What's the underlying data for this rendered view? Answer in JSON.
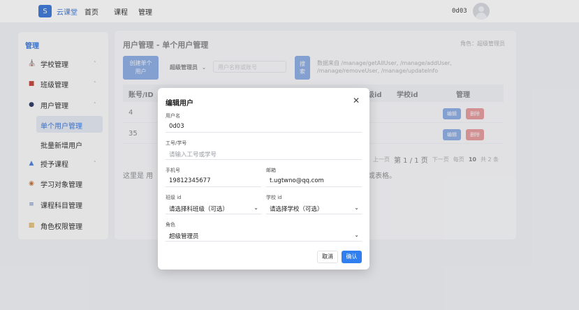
{
  "topnav": {
    "logo_letter": "S",
    "brand": "云课堂",
    "links": [
      "首页",
      "课程",
      "管理"
    ],
    "username": "0d03"
  },
  "sidebar": {
    "title": "管理",
    "items": [
      {
        "label": "学校管理",
        "icon": "school-icon"
      },
      {
        "label": "班级管理",
        "icon": "class-icon"
      },
      {
        "label": "用户管理",
        "icon": "user-icon"
      },
      {
        "label": "单个用户管理",
        "sub": true,
        "active": true
      },
      {
        "label": "批量新增用户",
        "sub": true
      },
      {
        "label": "授予课程",
        "icon": "grant-icon"
      },
      {
        "label": "学习对象管理",
        "icon": "target-icon"
      },
      {
        "label": "课程科目管理",
        "icon": "list-icon"
      },
      {
        "label": "角色权限管理",
        "icon": "lock-icon"
      }
    ]
  },
  "main": {
    "title": "用户管理 - 单个用户管理",
    "role": "角色：超级管理员",
    "create_button": "创建单个\n用户",
    "role_filter": "超级管理员",
    "search_placeholder": "用户名称或账号",
    "search_button": "搜\n索",
    "data_source": "数据来自 /manage/getAllUser, /manage/addUser, /manage/removeUser, /manage/updateInfo",
    "columns": [
      "账号/ID",
      "级id",
      "学校id",
      "管理"
    ],
    "rows": [
      {
        "id": "4",
        "edit": "编辑",
        "delete": "删除"
      },
      {
        "id": "35",
        "edit": "编辑",
        "delete": "删除"
      }
    ],
    "pager": {
      "prev": "上一页",
      "current": "第 1 / 1 页",
      "next": "下一页",
      "per_page_label": "每页",
      "per_page": "10",
      "total": "共 2 条"
    },
    "note_head": "这里是 用",
    "note_tail": "件或表格。"
  },
  "modal": {
    "title": "编辑用户",
    "username_label": "用户名",
    "username_value": "0d03",
    "workno_label": "工号/学号",
    "workno_placeholder": "请输入工号或学号",
    "phone_label": "手机号",
    "phone_value": "19812345677",
    "email_label": "邮箱",
    "email_value": "t.ugtwno@qq.com",
    "class_label": "班级 id",
    "class_value": "请选择科班级（可选）",
    "school_label": "学校 id",
    "school_value": "请选择学校（可选）",
    "role_label": "角色",
    "role_value": "超级管理员",
    "cancel": "取消",
    "confirm": "确认"
  },
  "colors": {
    "accent": "#2f6fd6",
    "danger": "#e04a4a",
    "confirm": "#2f7ff0"
  }
}
